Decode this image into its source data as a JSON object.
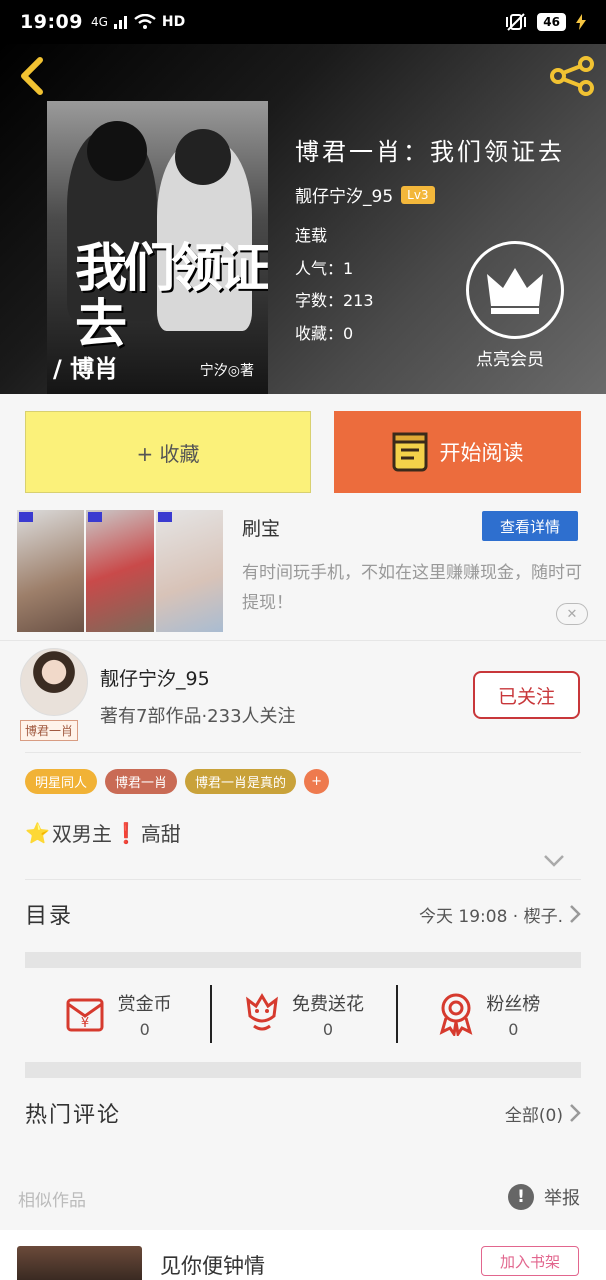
{
  "status_bar": {
    "time": "19:09",
    "network": "4G",
    "battery": "46"
  },
  "colors": {
    "accent_orange": "#ec6c3d",
    "fav_yellow": "#fbf17a",
    "follow_red": "#c8373a",
    "lv_badge": "#f3b73b",
    "detail_blue": "#2e6fcf"
  },
  "book": {
    "cover_title": "我们领证去",
    "cover_tag": "/ 博肖",
    "cover_author": "宁汐◎著",
    "title": "博君一肖：我们领证去",
    "author": "靓仔宁汐_95",
    "level": "Lv3",
    "status": "连载",
    "popularity": "人气：1",
    "word_count": "字数：213",
    "favorites": "收藏：0",
    "vip_label": "点亮会员"
  },
  "actions": {
    "favorite": "+ 收藏",
    "read": "开始阅读"
  },
  "ad": {
    "title": "刷宝",
    "detail_button": "查看详情",
    "description": "有时间玩手机，不如在这里赚赚现金，随时可提现！",
    "close": "✕"
  },
  "author_block": {
    "name": "靓仔宁汐_95",
    "stats": "著有7部作品·233人关注",
    "avatar_tag": "博君一肖",
    "follow_state": "已关注"
  },
  "tags": [
    {
      "label": "明星同人",
      "color": "#f1b236"
    },
    {
      "label": "博君一肖",
      "color": "#c96b55"
    },
    {
      "label": "博君一肖是真的",
      "color": "#c9a23a"
    },
    {
      "label": "+",
      "color": "#ee7a4e"
    }
  ],
  "synopsis": {
    "star": "⭐",
    "text1": "双男主",
    "mark": "❗",
    "text2": "高甜"
  },
  "catalog": {
    "label": "目录",
    "latest": "今天 19:08 · 楔子."
  },
  "rewards": [
    {
      "label": "赏金币",
      "value": "0",
      "icon": "red-envelope-icon"
    },
    {
      "label": "免费送花",
      "value": "0",
      "icon": "flower-icon"
    },
    {
      "label": "粉丝榜",
      "value": "0",
      "icon": "medal-icon"
    }
  ],
  "comments": {
    "label": "热门评论",
    "all": "全部(0)"
  },
  "footer": {
    "similar": "相似作品",
    "report": "举报",
    "report_icon": "!"
  },
  "similar_book": {
    "title": "见你便钟情",
    "add_button": "加入书架"
  }
}
